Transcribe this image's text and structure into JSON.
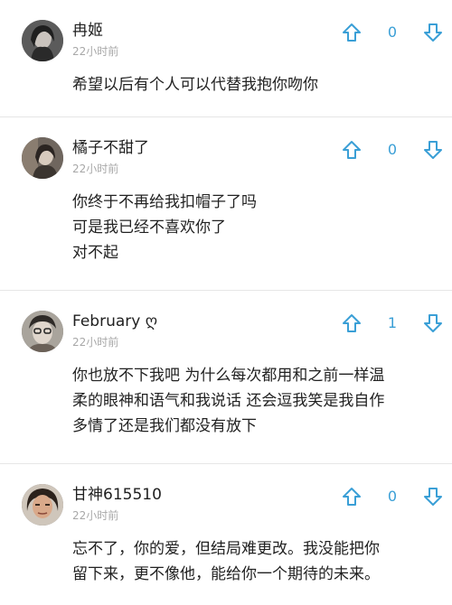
{
  "accent_color": "#3a9fd6",
  "comments": [
    {
      "username": "冉姬",
      "time": "22小时前",
      "votes": "0",
      "lines": [
        "希望以后有个人可以代替我抱你吻你"
      ]
    },
    {
      "username": "橘子不甜了",
      "time": "22小时前",
      "votes": "0",
      "lines": [
        "你终于不再给我扣帽子了吗",
        "可是我已经不喜欢你了",
        "对不起"
      ]
    },
    {
      "username": "February ღ",
      "time": "22小时前",
      "votes": "1",
      "lines": [
        "你也放不下我吧 为什么每次都用和之前一样温",
        "柔的眼神和语气和我说话 还会逗我笑是我自作",
        "多情了还是我们都没有放下"
      ]
    },
    {
      "username": "甘神615510",
      "time": "22小时前",
      "votes": "0",
      "lines": [
        "忘不了，你的爱，但结局难更改。我没能把你",
        "留下来，更不像他，能给你一个期待的未来。"
      ]
    }
  ],
  "icons": {
    "upvote": "upvote-arrow-icon",
    "downvote": "downvote-arrow-icon"
  }
}
